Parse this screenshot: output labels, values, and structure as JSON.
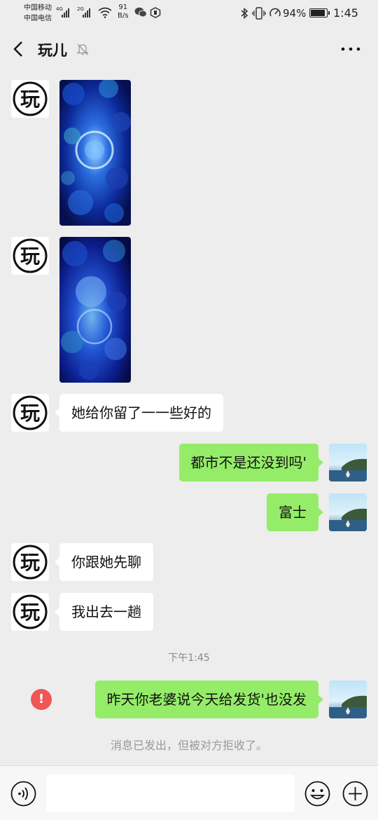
{
  "status_bar": {
    "carrier_1": "中国移动",
    "carrier_2": "中国电信",
    "sim1_type": "4G",
    "sim2_type": "2G",
    "net_speed_value": "91",
    "net_speed_unit": "B/s",
    "battery_percent": "94%",
    "battery_level": 0.94,
    "time": "1:45"
  },
  "header": {
    "title": "玩儿",
    "back_icon": "chevron-left-icon",
    "mute_icon": "bell-off-icon",
    "more_icon": "more-dots-icon"
  },
  "contact": {
    "avatar_char": "玩"
  },
  "messages": [
    {
      "side": "in",
      "type": "image"
    },
    {
      "side": "in",
      "type": "image"
    },
    {
      "side": "in",
      "type": "text",
      "text": "她给你留了一一些好的"
    },
    {
      "side": "out",
      "type": "text",
      "text": "都市不是还没到吗'"
    },
    {
      "side": "out",
      "type": "text",
      "text": "富士"
    },
    {
      "side": "in",
      "type": "text",
      "text": "你跟她先聊"
    },
    {
      "side": "in",
      "type": "text",
      "text": "我出去一趟"
    },
    {
      "side": "out",
      "type": "text",
      "text": "昨天你老婆说今天给发货'也没发",
      "failed": true
    }
  ],
  "timestamp": "下午1:45",
  "error_mark": "!",
  "rejected_notice": "消息已发出，但被对方拒收了。",
  "input_bar": {
    "voice_icon": "voice-icon",
    "emoji_icon": "emoji-icon",
    "plus_icon": "plus-icon"
  },
  "colors": {
    "background": "#ededed",
    "outgoing_bubble": "#95ec69",
    "incoming_bubble": "#ffffff",
    "error": "#f05654"
  }
}
